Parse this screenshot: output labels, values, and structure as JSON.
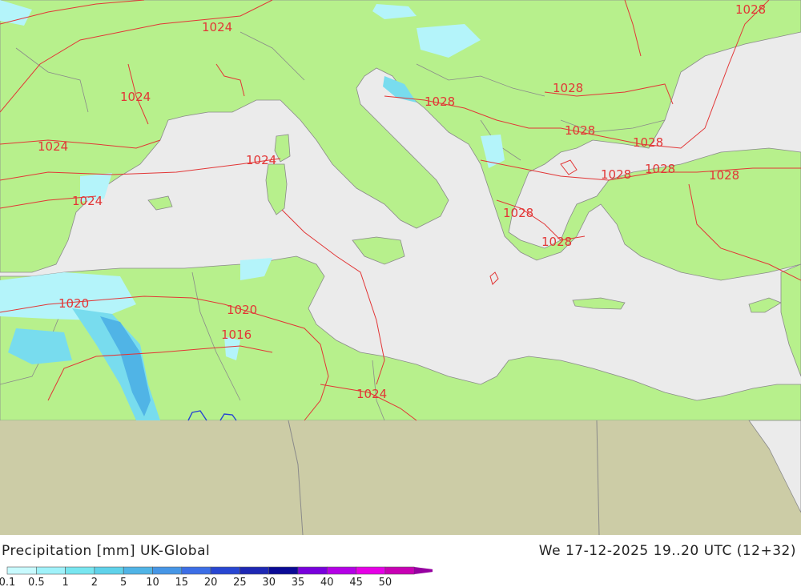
{
  "map": {
    "colors": {
      "sea": "#ebebeb",
      "land": "#b7f08c",
      "nodata": "#cccca6",
      "isobar": "#e23636",
      "border": "#8a8a8a",
      "precip_light": "#b4f4fa",
      "precip_medium": "#78dcee",
      "precip_heavy": "#50b4e6"
    },
    "isobar_labels": [
      "1028",
      "1024",
      "1024",
      "1024",
      "1024",
      "1024",
      "1028",
      "1028",
      "1028",
      "1028",
      "1028",
      "1028",
      "1028",
      "1028",
      "1028",
      "1020",
      "1020",
      "1016",
      "1024"
    ]
  },
  "footer": {
    "title": "Precipitation [mm] UK-Global",
    "datetime": "We 17-12-2025 19..20 UTC (12+32)"
  },
  "legend": {
    "ticks": [
      "0.1",
      "0.5",
      "1",
      "2",
      "5",
      "10",
      "15",
      "20",
      "25",
      "30",
      "35",
      "40",
      "45",
      "50"
    ],
    "colors": [
      "#c8fafe",
      "#a0f2fa",
      "#78e6f0",
      "#5fd2ea",
      "#50b4e6",
      "#4696e6",
      "#3c6ee6",
      "#2846d2",
      "#1e28b4",
      "#0a0a96",
      "#7800dc",
      "#b400e6",
      "#e600e6",
      "#c800b4",
      "#9600a0"
    ]
  }
}
